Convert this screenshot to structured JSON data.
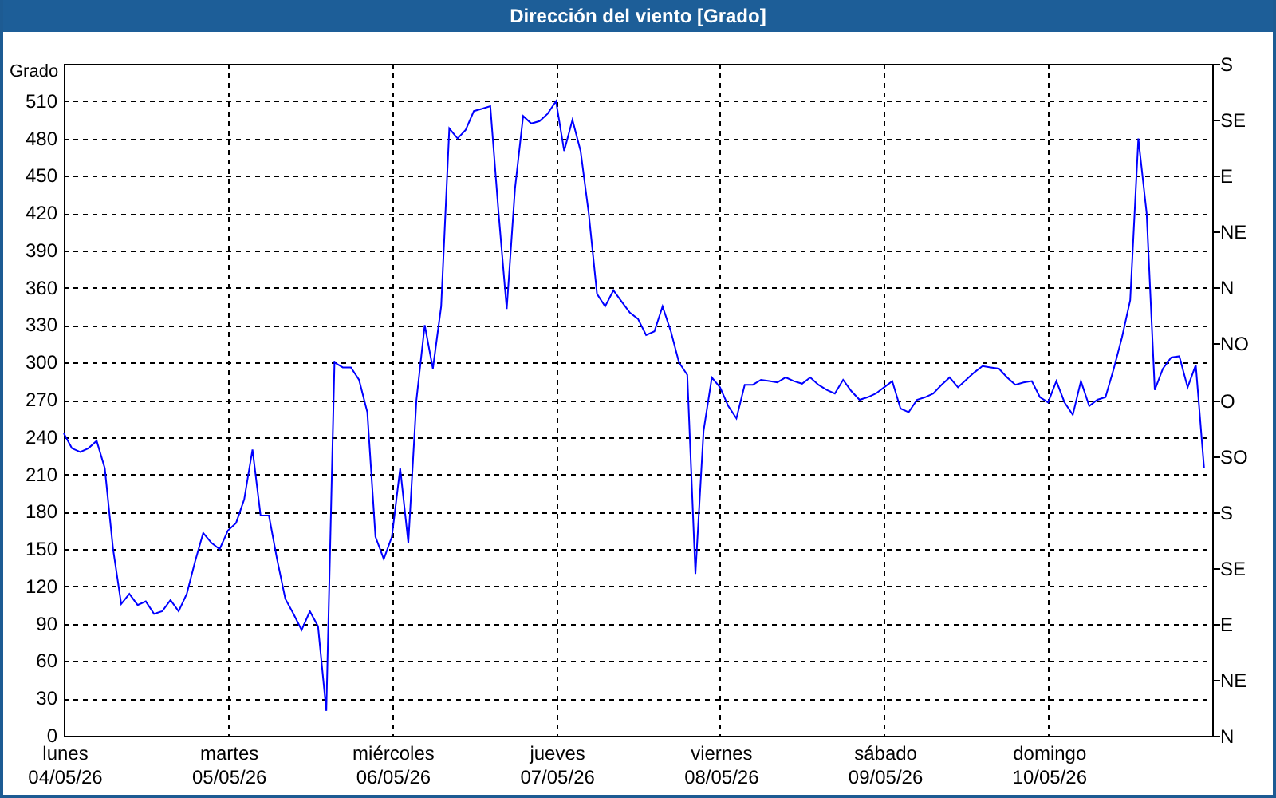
{
  "window": {
    "title": "Dirección del viento [Grado]"
  },
  "chart": {
    "chart_data": {
      "type": "line",
      "grid": true,
      "ylabel": "Grado",
      "ylim": [
        0,
        540
      ],
      "yticks": [
        0,
        30,
        60,
        90,
        120,
        150,
        180,
        210,
        240,
        270,
        300,
        330,
        360,
        390,
        420,
        450,
        480,
        510
      ],
      "categories": [
        "lunes 04/05/26",
        null,
        null,
        null,
        null,
        null,
        null,
        null,
        null,
        null,
        null,
        null,
        null,
        null,
        null,
        null,
        null,
        null,
        null,
        null,
        "martes 05/05/26",
        null,
        null,
        null,
        null,
        null,
        null,
        null,
        null,
        null,
        null,
        null,
        null,
        null,
        null,
        null,
        null,
        null,
        null,
        null,
        "miércoles 06/05/26",
        null,
        null,
        null,
        null,
        null,
        null,
        null,
        null,
        null,
        null,
        null,
        null,
        null,
        null,
        null,
        null,
        null,
        null,
        null,
        "jueves 07/05/26",
        null,
        null,
        null,
        null,
        null,
        null,
        null,
        null,
        null,
        null,
        null,
        null,
        null,
        null,
        null,
        null,
        null,
        null,
        null,
        "viernes 08/05/26",
        null,
        null,
        null,
        null,
        null,
        null,
        null,
        null,
        null,
        null,
        null,
        null,
        null,
        null,
        null,
        null,
        null,
        null,
        null,
        "sábado 09/05/26",
        null,
        null,
        null,
        null,
        null,
        null,
        null,
        null,
        null,
        null,
        null,
        null,
        null,
        null,
        null,
        null,
        null,
        null,
        null,
        "domingo 10/05/26",
        null,
        null,
        null,
        null,
        null,
        null,
        null,
        null,
        null,
        null,
        null,
        null,
        null,
        null,
        null,
        null,
        null,
        null,
        null
      ],
      "series": [
        {
          "color": "#0000ff",
          "values": [
            243,
            231,
            228,
            231,
            237,
            215,
            150,
            106,
            114,
            105,
            108,
            98,
            100,
            109,
            100,
            114,
            140,
            163,
            155,
            150,
            165,
            171,
            190,
            230,
            177,
            177,
            142,
            110,
            98,
            85,
            100,
            88,
            20,
            300,
            296,
            296,
            286,
            260,
            160,
            142,
            160,
            215,
            155,
            270,
            330,
            295,
            345,
            488,
            480,
            487,
            502,
            504,
            506,
            420,
            343,
            440,
            498,
            492,
            494,
            500,
            510,
            470,
            495,
            470,
            420,
            355,
            345,
            358,
            349,
            340,
            335,
            322,
            325,
            345,
            325,
            300,
            290,
            130,
            245,
            288,
            280,
            265,
            255,
            282,
            282,
            286,
            285,
            284,
            288,
            285,
            283,
            288,
            282,
            278,
            275,
            286,
            277,
            270,
            272,
            275,
            280,
            285,
            263,
            260,
            270,
            272,
            275,
            282,
            288,
            280,
            286,
            292,
            297,
            296,
            295,
            288,
            282,
            284,
            285,
            272,
            268,
            285,
            268,
            258,
            285,
            265,
            270,
            272,
            295,
            320,
            350,
            480,
            420,
            278,
            295,
            304,
            305,
            280,
            298,
            215
          ]
        }
      ]
    },
    "right_axis_labels": [
      "S",
      "SE",
      "E",
      "NE",
      "N",
      "NO",
      "O",
      "SO",
      "S",
      "SE",
      "E",
      "NE",
      "N"
    ]
  }
}
